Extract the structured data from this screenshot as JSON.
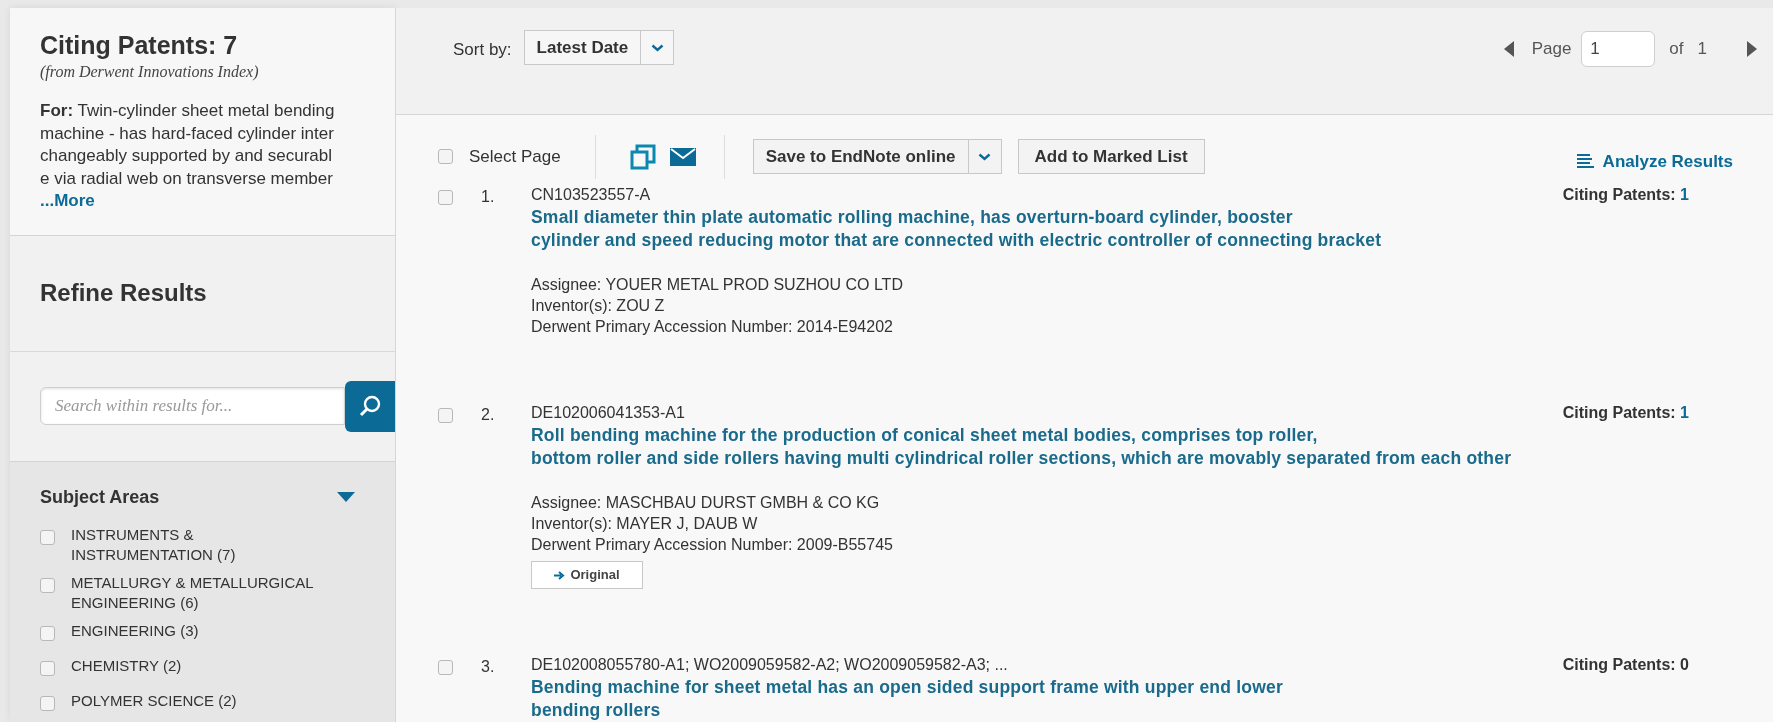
{
  "sidebar": {
    "heading": "Citing Patents: 7",
    "source": "(from Derwent Innovations Index)",
    "for_label": "For:",
    "for_text": "Twin-cylinder sheet metal bending machine - has hard-faced cylinder interchangeably supported by and securable via radial web on transverse member",
    "more_link": "...More",
    "refine_heading": "Refine Results",
    "search_placeholder": "Search within results for...",
    "subject_areas": {
      "heading": "Subject Areas",
      "expanded": true,
      "items": [
        {
          "label": "INSTRUMENTS & INSTRUMENTATION (7)",
          "checked": false
        },
        {
          "label": "METALLURGY & METALLURGICAL ENGINEERING (6)",
          "checked": false
        },
        {
          "label": "ENGINEERING (3)",
          "checked": false
        },
        {
          "label": "CHEMISTRY (2)",
          "checked": false
        },
        {
          "label": "POLYMER SCIENCE (2)",
          "checked": false
        }
      ]
    }
  },
  "sort": {
    "label": "Sort by:",
    "value": "Latest Date"
  },
  "pager": {
    "label": "Page",
    "value": "1",
    "of": "of",
    "total": "1"
  },
  "toolbar": {
    "select_page": "Select Page",
    "select_page_checked": false,
    "save_button": "Save to EndNote online",
    "marked_button": "Add to Marked List",
    "analyze_link": "Analyze Results"
  },
  "results": [
    {
      "number": "1.",
      "checked": false,
      "id": "CN103523557-A",
      "title_lines": [
        "Small diameter thin plate automatic rolling machine, has overturn-board cylinder, booster",
        "cylinder and speed reducing motor that are connected with electric controller of connecting bracket"
      ],
      "citing_label": "Citing Patents:",
      "citing_count": "1",
      "citing_zero": false,
      "details": [
        "Assignee: YOUER METAL PROD SUZHOU CO LTD",
        "Inventor(s): ZOU Z",
        "Derwent Primary Accession Number: 2014-E94202"
      ]
    },
    {
      "number": "2.",
      "checked": false,
      "id": "DE102006041353-A1",
      "title_lines": [
        "Roll bending machine for the production of conical sheet metal bodies, comprises top roller,",
        "bottom roller and side rollers having multi cylindrical roller sections, which are movably separated from each other"
      ],
      "citing_label": "Citing Patents:",
      "citing_count": "1",
      "citing_zero": false,
      "details": [
        "Assignee: MASCHBAU DURST GMBH & CO KG",
        "Inventor(s): MAYER J, DAUB W",
        "Derwent Primary Accession Number: 2009-B55745"
      ],
      "original_button": "Original"
    },
    {
      "number": "3.",
      "checked": false,
      "id": "DE102008055780-A1; WO2009059582-A2; WO2009059582-A3; ...",
      "title_lines": [
        "Bending machine for sheet metal has an open sided support frame with upper end lower",
        "bending rollers"
      ],
      "citing_label": "Citing Patents:",
      "citing_count": "0",
      "citing_zero": true
    }
  ]
}
